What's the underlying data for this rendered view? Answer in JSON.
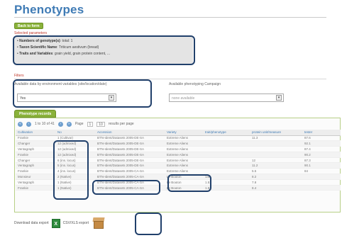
{
  "page": {
    "title": "Phenotypes"
  },
  "back_button": {
    "label": "Back to form"
  },
  "selection": {
    "label": "Selected parameters",
    "lines": [
      {
        "key": "Numbers of genotype(s)",
        "value": "total: 1"
      },
      {
        "key": "Taxon Scientific Name",
        "value": "Triticum aestivum (bread)"
      },
      {
        "key": "Traits and Variables",
        "value": "grain yield, grain protein content, ..."
      }
    ]
  },
  "filters": {
    "label": "Filters",
    "filter1": {
      "caption": "Available data by environment variables (site/location/date)",
      "value": "Yes"
    },
    "filter2": {
      "caption": "Available phenotyping Campaign",
      "value": "none available"
    }
  },
  "results": {
    "tab_label": "Phenotype records",
    "pager": {
      "range": "1 to 10 of 41",
      "page_label": "Page",
      "page": "1",
      "per_page": "10",
      "per_page_label": "results per page"
    },
    "columns": [
      "Cultivation",
      "No",
      "Accession",
      "Variety",
      "trait/phenotype",
      "protein unit/measure",
      "tester"
    ],
    "rows": [
      [
        "Frankie",
        "1 (Cultivar)",
        "BTN-Ident/Datasets 2005-DE-SA",
        "Extreme Aliens",
        "",
        "11.3",
        "87.6"
      ],
      [
        "Changer",
        "12 (admixed)",
        "BTN-Ident/Datasets 2005-DE-SA",
        "Extreme Aliens",
        "",
        "",
        "92.1"
      ],
      [
        "Ventagraph",
        "12 (admixed)",
        "BTN-Ident/Datasets 2005-DE-SA",
        "Extreme Aliens",
        "",
        "",
        "87.4"
      ],
      [
        "Frankie",
        "12 (admixed)",
        "BTN-Ident/Datasets 2005-DE-SA",
        "Extreme Aliens",
        "",
        "",
        "90.2"
      ],
      [
        "Changer",
        "6 (ins. locus)",
        "BTN-Ident/Datasets 2005-DE-SA",
        "Extreme Aliens",
        "",
        "12",
        "87.3"
      ],
      [
        "Ventagraph",
        "5 (ins. locus)",
        "BTN-Ident/Datasets 2005-DE-SA",
        "Extreme Aliens",
        "",
        "11.2",
        "90.1"
      ],
      [
        "Frankie",
        "4 (ins. locus)",
        "BTN-Ident/Datasets 2005-CA-SA",
        "Extreme Aliens",
        "",
        "5.5",
        "84"
      ],
      [
        "Monsieur",
        "2 (Native)",
        "BTN-Ident/Datasets 2005-CA-SA",
        "Le Bouton",
        "140",
        "8.2",
        ""
      ],
      [
        "Ventagraph",
        "1 (Native)",
        "BTN-Ident/Datasets 2005-CA-SA",
        "Le Bouton",
        "1.51",
        "7.8",
        ""
      ],
      [
        "Frankie",
        "1 (Native)",
        "BTN-Ident/Datasets 2005-CA-SA",
        "Le Bouton",
        "1.53",
        "8.4",
        ""
      ]
    ]
  },
  "export": {
    "label": "Download data export",
    "label2": "CSV/XLS export",
    "xls_icon_text": "X"
  },
  "colors": {
    "title": "#3f7bb5",
    "green": "#8ab23a",
    "highlight": "#21406b",
    "red_label": "#c0392b"
  }
}
